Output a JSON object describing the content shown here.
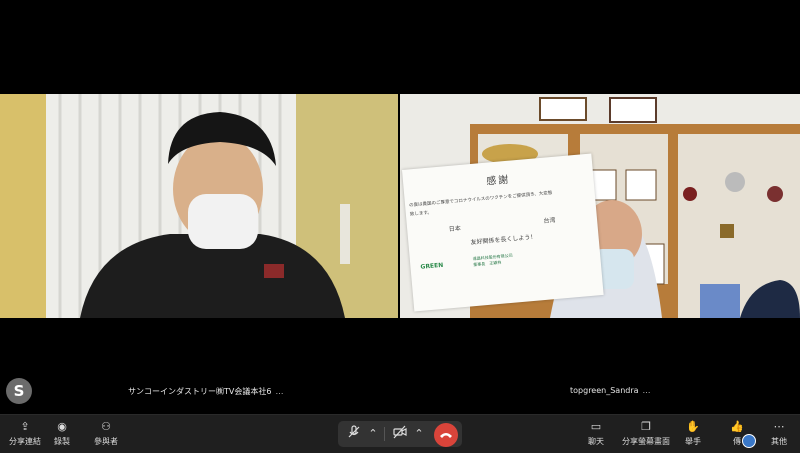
{
  "tiles": {
    "left_name": "サンコーインダストリー㈱TV会議本社6",
    "right_name": "topgreen_Sandra",
    "more": "…"
  },
  "paper": {
    "title": "感謝",
    "line1": "の度は貴国のご厚意でコロナウイルスのワクチンをご提供頂き、大変態",
    "line2": "致します。",
    "left_country": "日本",
    "right_country": "台湾",
    "friendship": "友好関係を長くしよう！",
    "logo_text": "GREEN",
    "company": "達昌科技股份有限公司",
    "signer": "董事長　王穎林"
  },
  "toolbar": {
    "share_link": "分享連結",
    "record": "錄製",
    "participants": "參與者",
    "chat": "聊天",
    "share_screen": "分享螢幕畫面",
    "raise_hand": "舉手",
    "send": "傳",
    "more": "其他",
    "more_glyph": "⋯"
  },
  "icons": {
    "share": "share-icon",
    "record": "record-icon",
    "people": "people-icon",
    "mic_muted": "mic-muted-icon",
    "cam_off": "camera-off-icon",
    "hangup": "hangup-icon",
    "chat": "chat-icon",
    "screen": "screen-share-icon",
    "hand": "raise-hand-icon",
    "thumb": "thumbs-up-icon"
  },
  "colors": {
    "hangup": "#d9443a",
    "toolbar_bg": "#1f1f1f"
  }
}
